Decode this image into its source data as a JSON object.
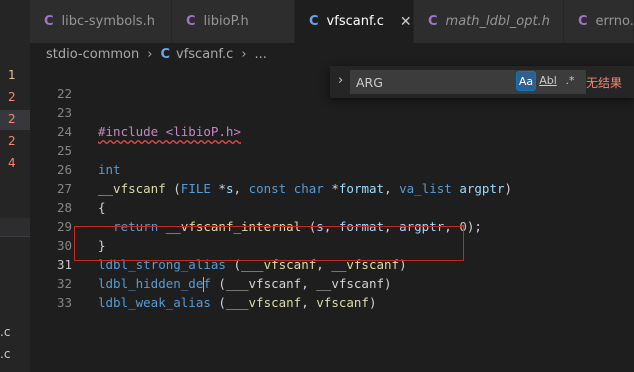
{
  "sidebar": {
    "badges": [
      "1",
      "2",
      "2",
      "2",
      "4"
    ],
    "files": [
      ".c",
      ".c"
    ]
  },
  "tabs": [
    {
      "icon": "C",
      "label": "libc-symbols.h",
      "active": false,
      "italic": false
    },
    {
      "icon": "C",
      "label": "libioP.h",
      "active": false,
      "italic": false
    },
    {
      "icon": "C",
      "label": "vfscanf.c",
      "active": true,
      "italic": false,
      "close": "✕"
    },
    {
      "icon": "C",
      "label": "math_ldbl_opt.h",
      "active": false,
      "italic": true
    },
    {
      "icon": "C",
      "label": "errno.h",
      "active": false,
      "italic": false
    }
  ],
  "breadcrumb": {
    "folder": "stdio-common",
    "sep": "›",
    "file_icon": "C",
    "file": "vfscanf.c",
    "rest": "..."
  },
  "find_widget": {
    "toggle_icon": "chevron-right-icon",
    "query": "ARG",
    "match_case_label": "Aa",
    "whole_word_label": "Abl",
    "regex_label": ".*",
    "result": "无结果"
  },
  "code_lines": [
    {
      "n": "22",
      "text": ""
    },
    {
      "n": "23",
      "text": "#include <libioP.h>"
    },
    {
      "n": "24",
      "text": ""
    },
    {
      "n": "25",
      "text": "int"
    },
    {
      "n": "26",
      "text": "__vfscanf (FILE *s, const char *format, va_list argptr)"
    },
    {
      "n": "27",
      "text": "{"
    },
    {
      "n": "28",
      "text": "  return __vfscanf_internal (s, format, argptr, 0);"
    },
    {
      "n": "29",
      "text": "}"
    },
    {
      "n": "30",
      "text": "ldbl_strong_alias (___vfscanf, __vfscanf)"
    },
    {
      "n": "31",
      "text": "ldbl_hidden_def (___vfscanf, __vfscanf)"
    },
    {
      "n": "32",
      "text": "ldbl_weak_alias (___vfscanf, vfscanf)"
    },
    {
      "n": "33",
      "text": ""
    }
  ],
  "colors": {
    "keyword": "#569cd6",
    "preprocessor": "#c586c0",
    "function": "#dcdcaa",
    "variable": "#9cdcfe",
    "number": "#b5cea8",
    "type": "#4ec9b0",
    "highlight_box": "#c42b1c",
    "no_result": "#f48771"
  }
}
